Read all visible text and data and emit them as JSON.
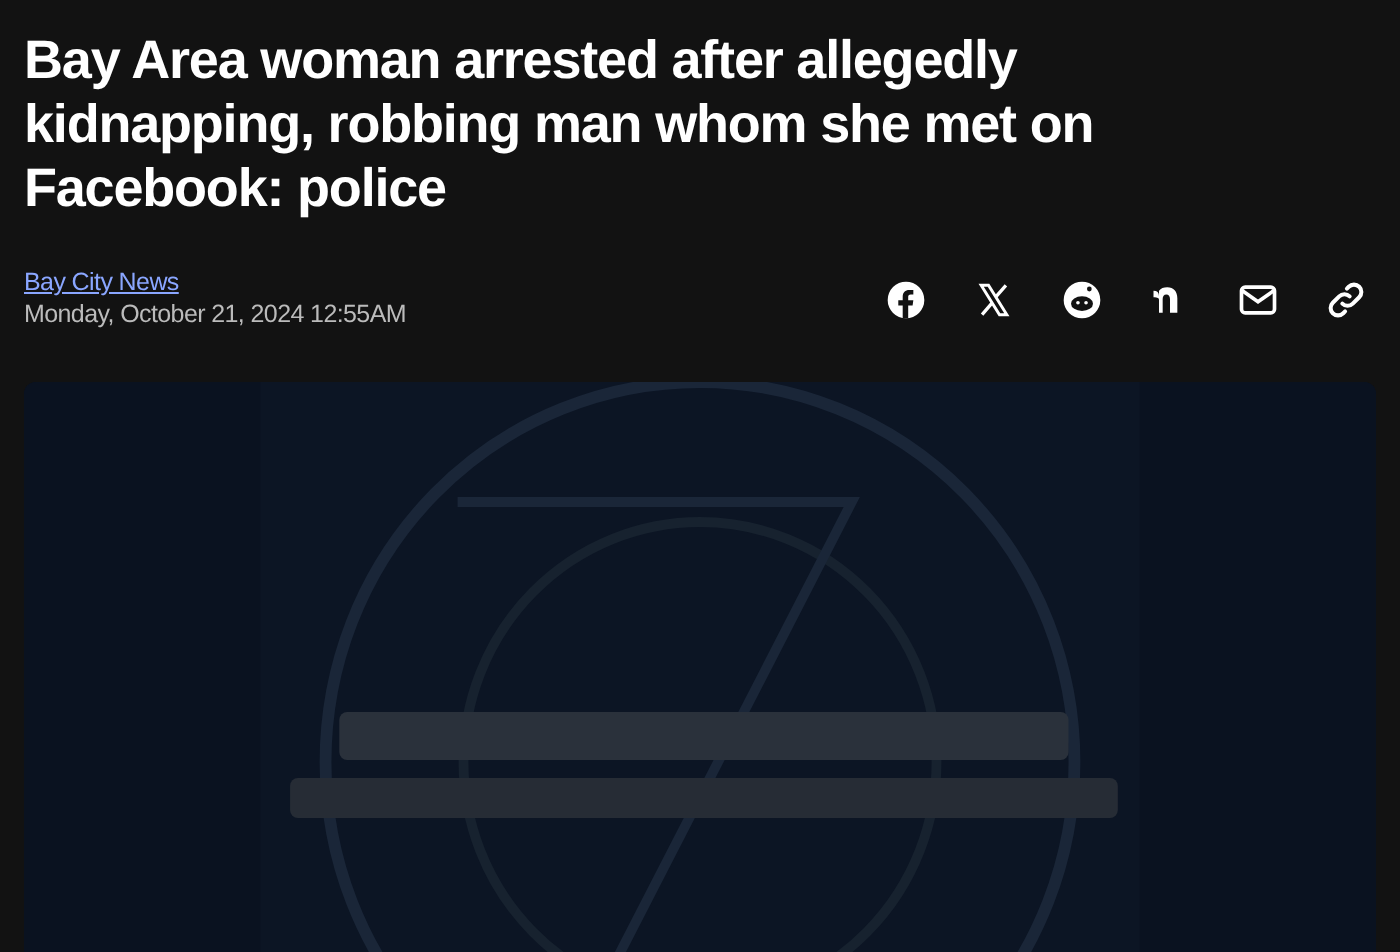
{
  "article": {
    "headline": "Bay Area woman arrested after allegedly kidnapping, robbing man whom she met on Facebook: police",
    "source": "Bay City News",
    "date": "Monday, October 21, 2024 12:55AM"
  }
}
